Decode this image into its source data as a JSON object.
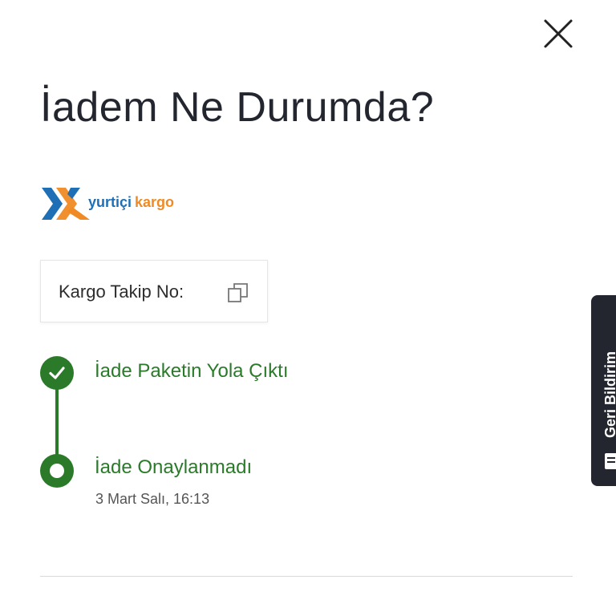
{
  "header": {
    "title": "İadem Ne Durumda?",
    "close_icon": "close-icon"
  },
  "brand": {
    "logo_text_primary": "yurtiçi",
    "logo_text_secondary": "kargo",
    "logo_icon": "yurtici-kargo-logo",
    "colors": {
      "blue": "#1e6fb5",
      "orange": "#f08a24"
    }
  },
  "tracking": {
    "label": "Kargo Takip No:",
    "copy_icon": "copy-icon"
  },
  "timeline": {
    "color": "#2a7a2a",
    "steps": [
      {
        "title": "İade Paketin Yola Çıktı",
        "status": "done",
        "icon": "check-icon"
      },
      {
        "title": "İade Onaylanmadı",
        "date": "3 Mart Salı, 16:13",
        "status": "current",
        "icon": "current-dot-icon"
      }
    ]
  },
  "side_tab": {
    "label": "Geri Bildirim",
    "icon": "feedback-icon",
    "color": "#23262e"
  }
}
